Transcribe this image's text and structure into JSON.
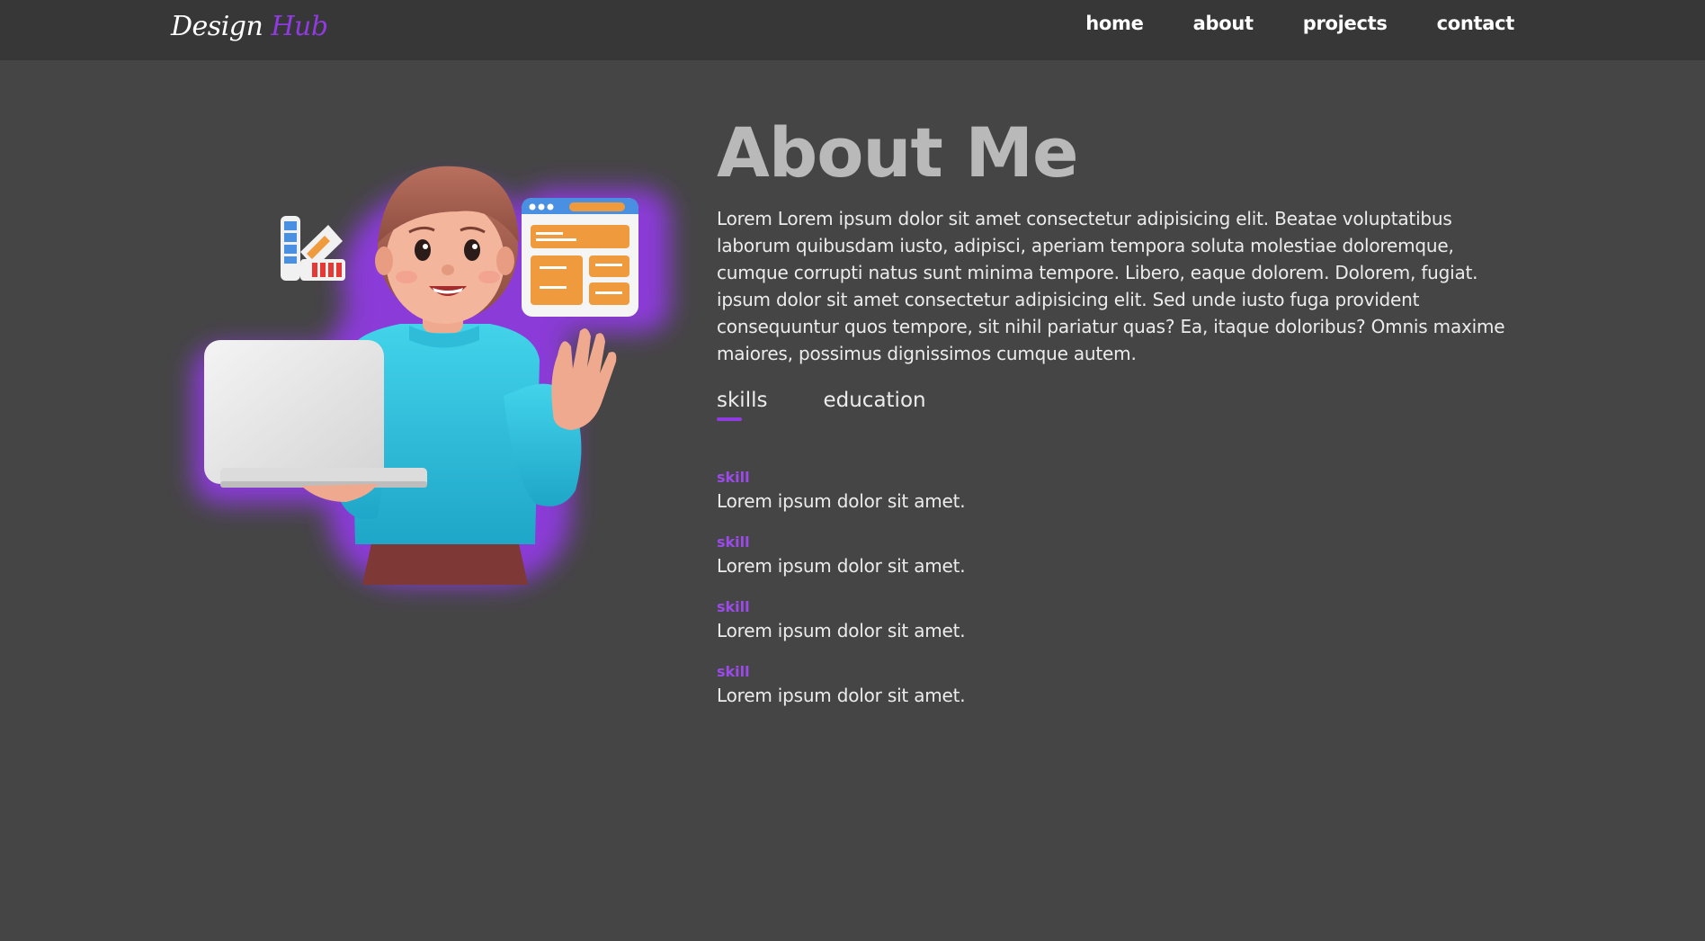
{
  "header": {
    "logo_main": "Design",
    "logo_accent": "Hub",
    "nav": [
      {
        "label": "home"
      },
      {
        "label": "about"
      },
      {
        "label": "projects"
      },
      {
        "label": "contact"
      }
    ]
  },
  "about": {
    "title": "About Me",
    "description": "Lorem Lorem ipsum dolor sit amet consectetur adipisicing elit. Beatae voluptatibus laborum quibusdam iusto, adipisci, aperiam tempora soluta molestiae doloremque, cumque corrupti natus sunt minima tempore. Libero, eaque dolorem. Dolorem, fugiat. ipsum dolor sit amet consectetur adipisicing elit. Sed unde iusto fuga provident consequuntur quos tempore, sit nihil pariatur quas? Ea, itaque doloribus? Omnis maxime maiores, possimus dignissimos cumque autem."
  },
  "tabs": [
    {
      "label": "skills",
      "active": true
    },
    {
      "label": "education",
      "active": false
    }
  ],
  "skills": [
    {
      "name": "skill",
      "description": "Lorem ipsum dolor sit amet."
    },
    {
      "name": "skill",
      "description": "Lorem ipsum dolor sit amet."
    },
    {
      "name": "skill",
      "description": "Lorem ipsum dolor sit amet."
    },
    {
      "name": "skill",
      "description": "Lorem ipsum dolor sit amet."
    }
  ],
  "illustration": {
    "icon": "designer-avatar-illustration",
    "glow_color": "#8f3be0"
  },
  "colors": {
    "background": "#454545",
    "header": "#373737",
    "accent": "#8f3be0",
    "title": "#b9b9b9"
  }
}
